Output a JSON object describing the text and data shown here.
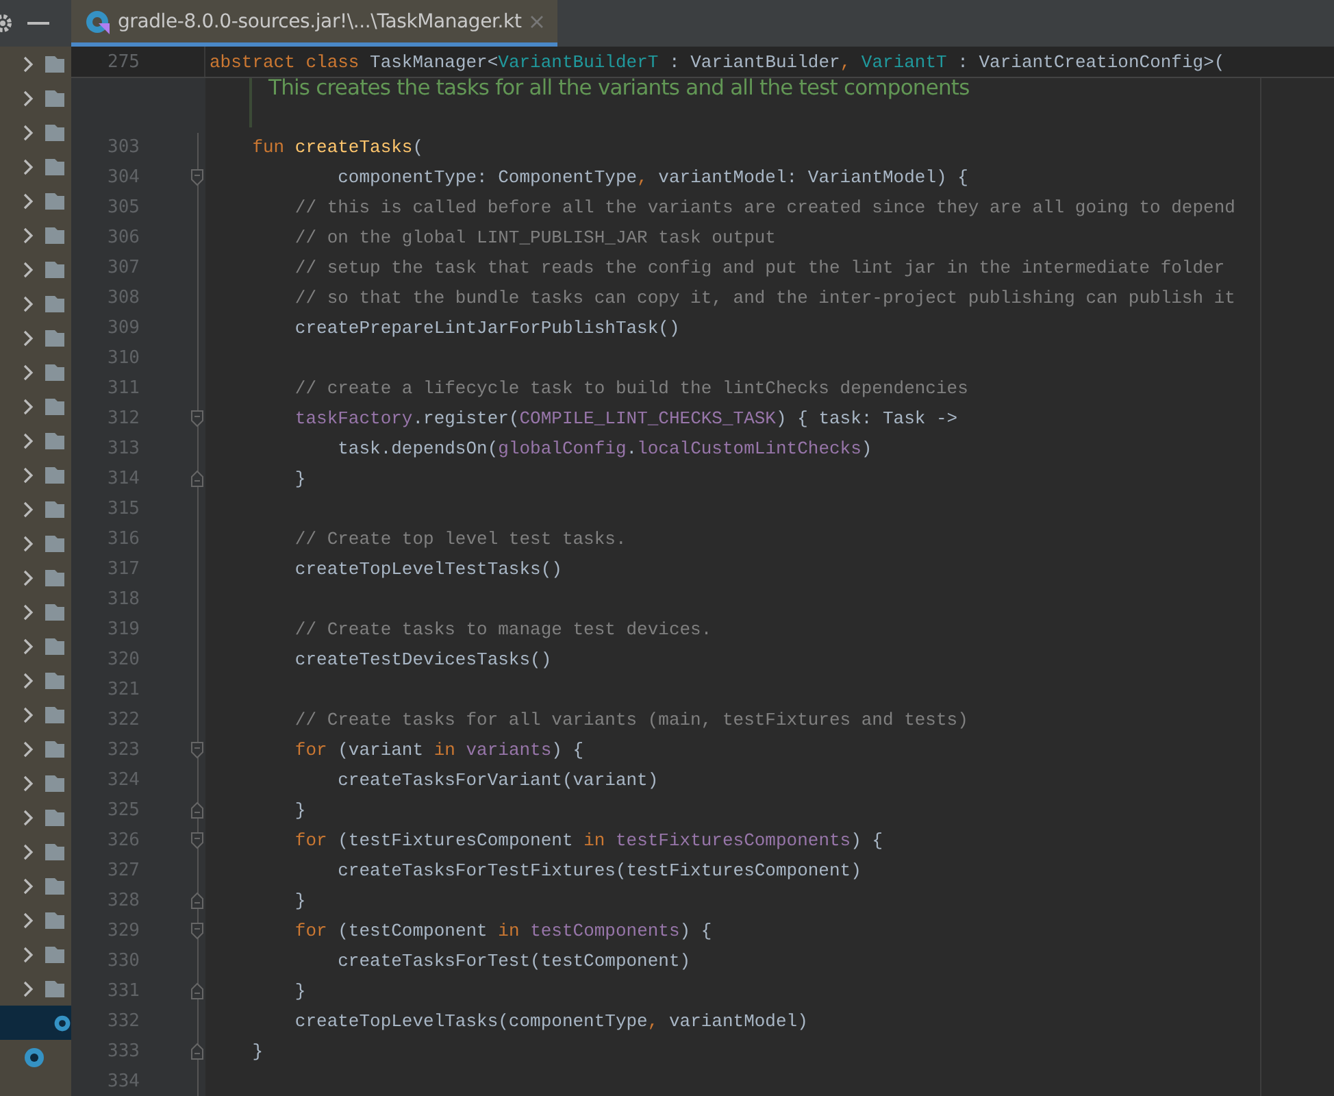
{
  "sidebar": {
    "items": [
      {
        "kind": "folder",
        "selected": false
      },
      {
        "kind": "folder",
        "selected": false
      },
      {
        "kind": "folder",
        "selected": false
      },
      {
        "kind": "folder",
        "selected": false
      },
      {
        "kind": "folder",
        "selected": false
      },
      {
        "kind": "folder",
        "selected": false
      },
      {
        "kind": "folder",
        "selected": false
      },
      {
        "kind": "folder",
        "selected": false
      },
      {
        "kind": "folder",
        "selected": false
      },
      {
        "kind": "folder",
        "selected": false
      },
      {
        "kind": "folder",
        "selected": false
      },
      {
        "kind": "folder",
        "selected": false
      },
      {
        "kind": "folder",
        "selected": false
      },
      {
        "kind": "folder",
        "selected": false
      },
      {
        "kind": "folder",
        "selected": false
      },
      {
        "kind": "folder",
        "selected": false
      },
      {
        "kind": "folder",
        "selected": false
      },
      {
        "kind": "folder",
        "selected": false
      },
      {
        "kind": "folder",
        "selected": false
      },
      {
        "kind": "folder",
        "selected": false
      },
      {
        "kind": "folder",
        "selected": false
      },
      {
        "kind": "folder",
        "selected": false
      },
      {
        "kind": "folder",
        "selected": false
      },
      {
        "kind": "folder",
        "selected": false
      },
      {
        "kind": "folder",
        "selected": false
      },
      {
        "kind": "folder",
        "selected": false
      },
      {
        "kind": "folder",
        "selected": false
      },
      {
        "kind": "folder",
        "selected": false
      },
      {
        "kind": "file",
        "selected": true
      },
      {
        "kind": "file",
        "selected": false
      }
    ]
  },
  "tab": {
    "title": "gradle-8.0.0-sources.jar!\\...\\TaskManager.kt",
    "selected": true
  },
  "sticky_line": {
    "number": "275",
    "tokens": [
      {
        "text": "abstract class ",
        "kind": "keyword"
      },
      {
        "text": "TaskManager<",
        "kind": "plain"
      },
      {
        "text": "VariantBuilderT",
        "kind": "typeparam"
      },
      {
        "text": " : VariantBuilder",
        "kind": "plain"
      },
      {
        "text": ", ",
        "kind": "keyword"
      },
      {
        "text": "VariantT",
        "kind": "typeparam"
      },
      {
        "text": " : VariantCreationConfig>(",
        "kind": "plain"
      }
    ]
  },
  "doc_comment": "This creates the tasks for all the variants and all the test components",
  "lines": [
    {
      "number": "303",
      "tokens": [
        {
          "text": "    fun ",
          "kind": "keyword"
        },
        {
          "text": "createTasks",
          "kind": "function"
        },
        {
          "text": "(",
          "kind": "plain"
        }
      ]
    },
    {
      "number": "304",
      "fold_open": true,
      "tokens": [
        {
          "text": "            componentType: ComponentType",
          "kind": "plain"
        },
        {
          "text": ", ",
          "kind": "keyword"
        },
        {
          "text": "variantModel: VariantModel) {",
          "kind": "plain"
        }
      ]
    },
    {
      "number": "305",
      "tokens": [
        {
          "text": "        // this is called before all the variants are created since they are all going to depend",
          "kind": "comment"
        }
      ]
    },
    {
      "number": "306",
      "tokens": [
        {
          "text": "        // on the global LINT_PUBLISH_JAR task output",
          "kind": "comment"
        }
      ]
    },
    {
      "number": "307",
      "tokens": [
        {
          "text": "        // setup the task that reads the config and put the lint jar in the intermediate folder",
          "kind": "comment"
        }
      ]
    },
    {
      "number": "308",
      "tokens": [
        {
          "text": "        // so that the bundle tasks can copy it, and the inter-project publishing can publish it",
          "kind": "comment"
        }
      ]
    },
    {
      "number": "309",
      "tokens": [
        {
          "text": "        createPrepareLintJarForPublishTask()",
          "kind": "plain"
        }
      ]
    },
    {
      "number": "310"
    },
    {
      "number": "311",
      "tokens": [
        {
          "text": "        // create a lifecycle task to build the lintChecks dependencies",
          "kind": "comment"
        }
      ]
    },
    {
      "number": "312",
      "fold_open": true,
      "tokens": [
        {
          "text": "        taskFactory",
          "kind": "field"
        },
        {
          "text": ".register(",
          "kind": "plain"
        },
        {
          "text": "COMPILE_LINT_CHECKS_TASK",
          "kind": "field"
        },
        {
          "text": ") { task: Task ->",
          "kind": "plain"
        }
      ]
    },
    {
      "number": "313",
      "tokens": [
        {
          "text": "            task.dependsOn(",
          "kind": "plain"
        },
        {
          "text": "globalConfig",
          "kind": "field"
        },
        {
          "text": ".",
          "kind": "plain"
        },
        {
          "text": "localCustomLintChecks",
          "kind": "field"
        },
        {
          "text": ")",
          "kind": "plain"
        }
      ]
    },
    {
      "number": "314",
      "fold_close": true,
      "tokens": [
        {
          "text": "        }",
          "kind": "plain"
        }
      ]
    },
    {
      "number": "315"
    },
    {
      "number": "316",
      "tokens": [
        {
          "text": "        // Create top level test tasks.",
          "kind": "comment"
        }
      ]
    },
    {
      "number": "317",
      "tokens": [
        {
          "text": "        createTopLevelTestTasks()",
          "kind": "plain"
        }
      ]
    },
    {
      "number": "318"
    },
    {
      "number": "319",
      "tokens": [
        {
          "text": "        // Create tasks to manage test devices.",
          "kind": "comment"
        }
      ]
    },
    {
      "number": "320",
      "tokens": [
        {
          "text": "        createTestDevicesTasks()",
          "kind": "plain"
        }
      ]
    },
    {
      "number": "321"
    },
    {
      "number": "322",
      "tokens": [
        {
          "text": "        // Create tasks for all variants (main, testFixtures and tests)",
          "kind": "comment"
        }
      ]
    },
    {
      "number": "323",
      "fold_open": true,
      "tokens": [
        {
          "text": "        for ",
          "kind": "keyword"
        },
        {
          "text": "(variant ",
          "kind": "plain"
        },
        {
          "text": "in ",
          "kind": "keyword"
        },
        {
          "text": "variants",
          "kind": "field"
        },
        {
          "text": ") {",
          "kind": "plain"
        }
      ]
    },
    {
      "number": "324",
      "tokens": [
        {
          "text": "            createTasksForVariant(variant)",
          "kind": "plain"
        }
      ]
    },
    {
      "number": "325",
      "fold_close": true,
      "tokens": [
        {
          "text": "        }",
          "kind": "plain"
        }
      ]
    },
    {
      "number": "326",
      "fold_open": true,
      "tokens": [
        {
          "text": "        for ",
          "kind": "keyword"
        },
        {
          "text": "(testFixturesComponent ",
          "kind": "plain"
        },
        {
          "text": "in ",
          "kind": "keyword"
        },
        {
          "text": "testFixturesComponents",
          "kind": "field"
        },
        {
          "text": ") {",
          "kind": "plain"
        }
      ]
    },
    {
      "number": "327",
      "tokens": [
        {
          "text": "            createTasksForTestFixtures(testFixturesComponent)",
          "kind": "plain"
        }
      ]
    },
    {
      "number": "328",
      "fold_close": true,
      "tokens": [
        {
          "text": "        }",
          "kind": "plain"
        }
      ]
    },
    {
      "number": "329",
      "fold_open": true,
      "tokens": [
        {
          "text": "        for ",
          "kind": "keyword"
        },
        {
          "text": "(testComponent ",
          "kind": "plain"
        },
        {
          "text": "in ",
          "kind": "keyword"
        },
        {
          "text": "testComponents",
          "kind": "field"
        },
        {
          "text": ") {",
          "kind": "plain"
        }
      ]
    },
    {
      "number": "330",
      "tokens": [
        {
          "text": "            createTasksForTest(testComponent)",
          "kind": "plain"
        }
      ]
    },
    {
      "number": "331",
      "fold_close": true,
      "tokens": [
        {
          "text": "        }",
          "kind": "plain"
        }
      ]
    },
    {
      "number": "332",
      "tokens": [
        {
          "text": "        createTopLevelTasks(componentType",
          "kind": "plain"
        },
        {
          "text": ", ",
          "kind": "keyword"
        },
        {
          "text": "variantModel)",
          "kind": "plain"
        }
      ]
    },
    {
      "number": "333",
      "fold_close": true,
      "tokens": [
        {
          "text": "    }",
          "kind": "plain"
        }
      ]
    },
    {
      "number": "334"
    }
  ]
}
